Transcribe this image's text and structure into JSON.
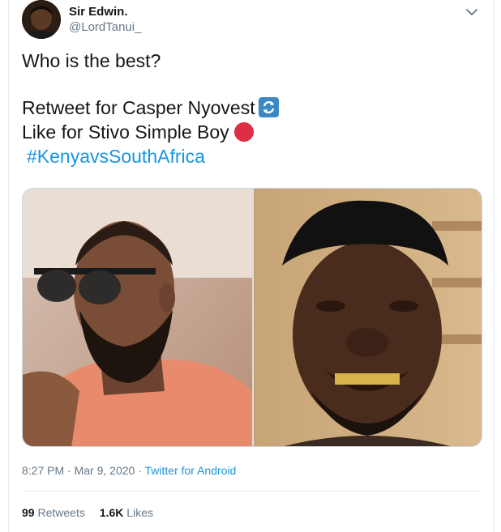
{
  "user": {
    "display_name": "Sir Edwin.",
    "handle": "@LordTanui_"
  },
  "tweet": {
    "line1": "Who is the best?",
    "line2": "Retweet for Casper Nyovest",
    "line3": "Like for Stivo Simple Boy",
    "hashtag": "#KenyavsSouthAfrica",
    "emoji_1": "retweet-emoji-icon",
    "emoji_2": "red-circle-emoji-icon"
  },
  "meta": {
    "time": "8:27 PM",
    "sep1": "·",
    "date": "Mar 9, 2020",
    "sep2": "·",
    "source": "Twitter for Android"
  },
  "stats": {
    "retweets_count": "99",
    "retweets_label": "Retweets",
    "likes_count": "1.6K",
    "likes_label": "Likes"
  },
  "colors": {
    "link": "#1b95e0",
    "secondary_text": "#657786",
    "primary_text": "#14171a"
  }
}
